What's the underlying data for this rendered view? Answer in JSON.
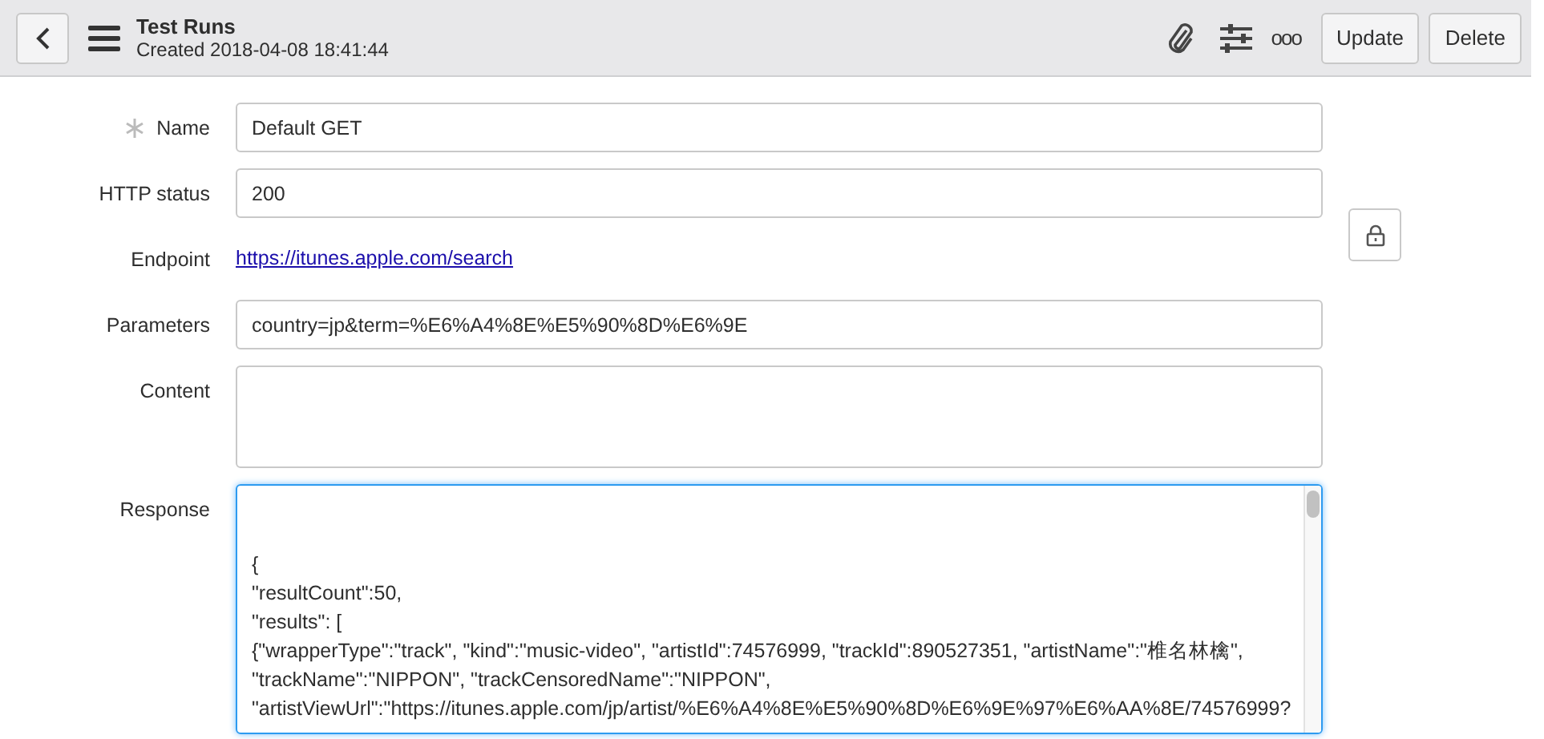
{
  "header": {
    "title": "Test Runs",
    "subtitle": "Created 2018-04-08 18:41:44",
    "more": "ooo",
    "buttons": [
      "Update",
      "Delete"
    ]
  },
  "fields": [
    {
      "kind": "input",
      "label": "Name",
      "required": true,
      "value": "Default GET"
    },
    {
      "kind": "input",
      "label": "HTTP status",
      "required": false,
      "value": "200"
    },
    {
      "kind": "link",
      "label": "Endpoint",
      "required": false,
      "value": "https://itunes.apple.com/search",
      "locked": true
    },
    {
      "kind": "input",
      "label": "Parameters",
      "required": false,
      "value": "country=jp&term=%E6%A4%8E%E5%90%8D%E6%9E"
    },
    {
      "kind": "textarea",
      "label": "Content",
      "required": false
    },
    {
      "kind": "response",
      "label": "Response",
      "required": false,
      "focused": true,
      "lines": [
        "{",
        " \"resultCount\":50,",
        " \"results\": [",
        "{\"wrapperType\":\"track\", \"kind\":\"music-video\", \"artistId\":74576999, \"trackId\":890527351, \"artistName\":\"椎名林檎\",",
        "\"trackName\":\"NIPPON\", \"trackCensoredName\":\"NIPPON\",",
        "\"artistViewUrl\":\"https://itunes.apple.com/jp/artist/%E6%A4%8E%E5%90%8D%E6%9E%97%E6%AA%8E/74576999?"
      ]
    }
  ]
}
